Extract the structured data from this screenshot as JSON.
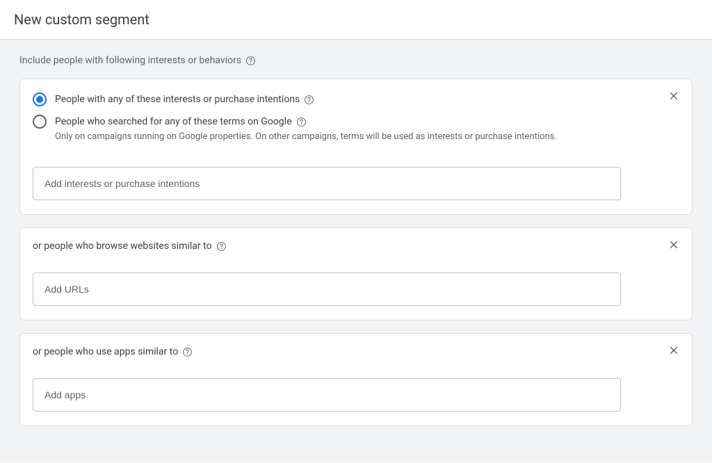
{
  "header": {
    "title": "New custom segment"
  },
  "section": {
    "label": "Include people with following interests or behaviors"
  },
  "card1": {
    "radio1": {
      "label": "People with any of these interests or purchase intentions"
    },
    "radio2": {
      "label": "People who searched for any of these terms on Google",
      "sub": "Only on campaigns running on Google properties. On other campaigns, terms will be used as interests or purchase intentions."
    },
    "input_placeholder": "Add interests or purchase intentions"
  },
  "card2": {
    "label": "or people who browse websites similar to",
    "input_placeholder": "Add URLs"
  },
  "card3": {
    "label": "or people who use apps similar to",
    "input_placeholder": "Add apps"
  }
}
